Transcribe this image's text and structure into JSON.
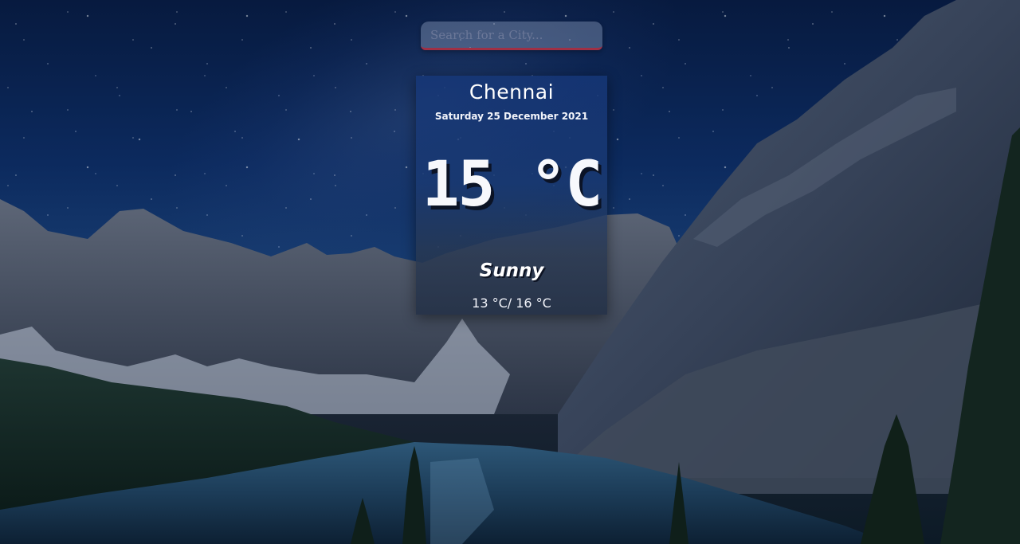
{
  "search": {
    "placeholder": "Search for a City..."
  },
  "weather": {
    "city": "Chennai",
    "date": "Saturday 25 December 2021",
    "temperature": "15 °C",
    "condition": "Sunny",
    "range": "13 °C/ 16 °C"
  },
  "colors": {
    "sky_top": "#071a3f",
    "card_bg": "#163778",
    "search_underline": "#a03045",
    "text": "#ffffff"
  }
}
